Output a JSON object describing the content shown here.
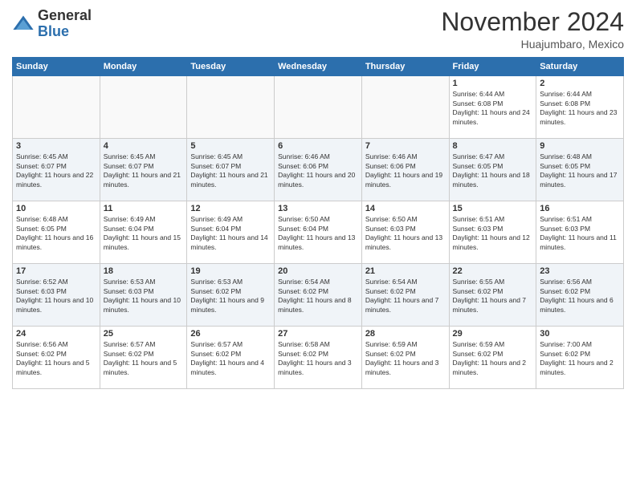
{
  "logo": {
    "general": "General",
    "blue": "Blue"
  },
  "title": "November 2024",
  "location": "Huajumbaro, Mexico",
  "headers": [
    "Sunday",
    "Monday",
    "Tuesday",
    "Wednesday",
    "Thursday",
    "Friday",
    "Saturday"
  ],
  "weeks": [
    [
      {
        "day": "",
        "info": ""
      },
      {
        "day": "",
        "info": ""
      },
      {
        "day": "",
        "info": ""
      },
      {
        "day": "",
        "info": ""
      },
      {
        "day": "",
        "info": ""
      },
      {
        "day": "1",
        "info": "Sunrise: 6:44 AM\nSunset: 6:08 PM\nDaylight: 11 hours and 24 minutes."
      },
      {
        "day": "2",
        "info": "Sunrise: 6:44 AM\nSunset: 6:08 PM\nDaylight: 11 hours and 23 minutes."
      }
    ],
    [
      {
        "day": "3",
        "info": "Sunrise: 6:45 AM\nSunset: 6:07 PM\nDaylight: 11 hours and 22 minutes."
      },
      {
        "day": "4",
        "info": "Sunrise: 6:45 AM\nSunset: 6:07 PM\nDaylight: 11 hours and 21 minutes."
      },
      {
        "day": "5",
        "info": "Sunrise: 6:45 AM\nSunset: 6:07 PM\nDaylight: 11 hours and 21 minutes."
      },
      {
        "day": "6",
        "info": "Sunrise: 6:46 AM\nSunset: 6:06 PM\nDaylight: 11 hours and 20 minutes."
      },
      {
        "day": "7",
        "info": "Sunrise: 6:46 AM\nSunset: 6:06 PM\nDaylight: 11 hours and 19 minutes."
      },
      {
        "day": "8",
        "info": "Sunrise: 6:47 AM\nSunset: 6:05 PM\nDaylight: 11 hours and 18 minutes."
      },
      {
        "day": "9",
        "info": "Sunrise: 6:48 AM\nSunset: 6:05 PM\nDaylight: 11 hours and 17 minutes."
      }
    ],
    [
      {
        "day": "10",
        "info": "Sunrise: 6:48 AM\nSunset: 6:05 PM\nDaylight: 11 hours and 16 minutes."
      },
      {
        "day": "11",
        "info": "Sunrise: 6:49 AM\nSunset: 6:04 PM\nDaylight: 11 hours and 15 minutes."
      },
      {
        "day": "12",
        "info": "Sunrise: 6:49 AM\nSunset: 6:04 PM\nDaylight: 11 hours and 14 minutes."
      },
      {
        "day": "13",
        "info": "Sunrise: 6:50 AM\nSunset: 6:04 PM\nDaylight: 11 hours and 13 minutes."
      },
      {
        "day": "14",
        "info": "Sunrise: 6:50 AM\nSunset: 6:03 PM\nDaylight: 11 hours and 13 minutes."
      },
      {
        "day": "15",
        "info": "Sunrise: 6:51 AM\nSunset: 6:03 PM\nDaylight: 11 hours and 12 minutes."
      },
      {
        "day": "16",
        "info": "Sunrise: 6:51 AM\nSunset: 6:03 PM\nDaylight: 11 hours and 11 minutes."
      }
    ],
    [
      {
        "day": "17",
        "info": "Sunrise: 6:52 AM\nSunset: 6:03 PM\nDaylight: 11 hours and 10 minutes."
      },
      {
        "day": "18",
        "info": "Sunrise: 6:53 AM\nSunset: 6:03 PM\nDaylight: 11 hours and 10 minutes."
      },
      {
        "day": "19",
        "info": "Sunrise: 6:53 AM\nSunset: 6:02 PM\nDaylight: 11 hours and 9 minutes."
      },
      {
        "day": "20",
        "info": "Sunrise: 6:54 AM\nSunset: 6:02 PM\nDaylight: 11 hours and 8 minutes."
      },
      {
        "day": "21",
        "info": "Sunrise: 6:54 AM\nSunset: 6:02 PM\nDaylight: 11 hours and 7 minutes."
      },
      {
        "day": "22",
        "info": "Sunrise: 6:55 AM\nSunset: 6:02 PM\nDaylight: 11 hours and 7 minutes."
      },
      {
        "day": "23",
        "info": "Sunrise: 6:56 AM\nSunset: 6:02 PM\nDaylight: 11 hours and 6 minutes."
      }
    ],
    [
      {
        "day": "24",
        "info": "Sunrise: 6:56 AM\nSunset: 6:02 PM\nDaylight: 11 hours and 5 minutes."
      },
      {
        "day": "25",
        "info": "Sunrise: 6:57 AM\nSunset: 6:02 PM\nDaylight: 11 hours and 5 minutes."
      },
      {
        "day": "26",
        "info": "Sunrise: 6:57 AM\nSunset: 6:02 PM\nDaylight: 11 hours and 4 minutes."
      },
      {
        "day": "27",
        "info": "Sunrise: 6:58 AM\nSunset: 6:02 PM\nDaylight: 11 hours and 3 minutes."
      },
      {
        "day": "28",
        "info": "Sunrise: 6:59 AM\nSunset: 6:02 PM\nDaylight: 11 hours and 3 minutes."
      },
      {
        "day": "29",
        "info": "Sunrise: 6:59 AM\nSunset: 6:02 PM\nDaylight: 11 hours and 2 minutes."
      },
      {
        "day": "30",
        "info": "Sunrise: 7:00 AM\nSunset: 6:02 PM\nDaylight: 11 hours and 2 minutes."
      }
    ]
  ]
}
